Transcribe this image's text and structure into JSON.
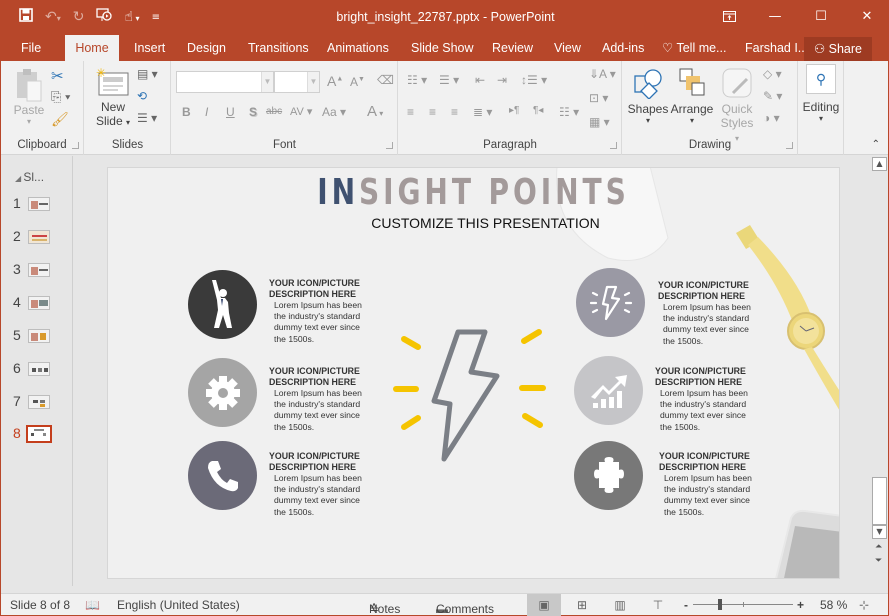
{
  "window": {
    "title": "bright_insight_22787.pptx - PowerPoint",
    "controls": [
      "ribbon-display-options",
      "minimize",
      "maximize",
      "close"
    ]
  },
  "quick_access": [
    "save-icon",
    "undo-icon",
    "redo-icon",
    "start-from-beginning-icon",
    "touch-mode-icon",
    "customize-qat-icon"
  ],
  "tabs": [
    {
      "label": "File"
    },
    {
      "label": "Home",
      "active": true
    },
    {
      "label": "Insert"
    },
    {
      "label": "Design"
    },
    {
      "label": "Transitions"
    },
    {
      "label": "Animations"
    },
    {
      "label": "Slide Show"
    },
    {
      "label": "Review"
    },
    {
      "label": "View"
    },
    {
      "label": "Add-ins"
    },
    {
      "label": "Tell me..."
    },
    {
      "label": "Farshad I..."
    }
  ],
  "share_label": "Share",
  "ribbon": {
    "groups": {
      "clipboard": {
        "label": "Clipboard",
        "paste": "Paste"
      },
      "slides": {
        "label": "Slides",
        "new_slide_1": "New",
        "new_slide_2": "Slide"
      },
      "font": {
        "label": "Font",
        "font_name": "",
        "font_size": "",
        "buttons": [
          "B",
          "I",
          "U",
          "S",
          "abc",
          "AV",
          "Aa",
          "A"
        ]
      },
      "paragraph": {
        "label": "Paragraph"
      },
      "drawing": {
        "label": "Drawing",
        "shapes": "Shapes",
        "arrange": "Arrange",
        "quick_1": "Quick",
        "quick_2": "Styles"
      },
      "editing": {
        "label": "Editing"
      }
    }
  },
  "slides_pane": {
    "header": "Sl...",
    "slides": [
      {
        "num": "1"
      },
      {
        "num": "2"
      },
      {
        "num": "3"
      },
      {
        "num": "4"
      },
      {
        "num": "5"
      },
      {
        "num": "6"
      },
      {
        "num": "7"
      },
      {
        "num": "8",
        "selected": true
      }
    ]
  },
  "slide": {
    "title_highlight": "IN",
    "title_rest": "SIGHT POINTS",
    "subtitle": "CUSTOMIZE THIS PRESENTATION",
    "items": [
      {
        "icon": "celebrating-person-icon",
        "color": "#3a3a3a",
        "heading1": "YOUR ICON/PICTURE",
        "heading2": "DESCRIPTION HERE",
        "body": [
          "Lorem Ipsum has been",
          "the industry's standard",
          "dummy text ever since",
          "the 1500s."
        ]
      },
      {
        "icon": "gear-icon",
        "color": "#a5a5a5",
        "heading1": "YOUR ICON/PICTURE",
        "heading2": "DESCRIPTION HERE",
        "body": [
          "Lorem Ipsum has been",
          "the industry's standard",
          "dummy text ever since",
          "the 1500s."
        ]
      },
      {
        "icon": "phone-icon",
        "color": "#6b6a78",
        "heading1": "YOUR ICON/PICTURE",
        "heading2": "DESCRIPTION HERE",
        "body": [
          "Lorem Ipsum has been",
          "the industry's standard",
          "dummy text ever since",
          "the 1500s."
        ]
      },
      {
        "icon": "lightning-icon",
        "color": "#9a99a4",
        "heading1": "YOUR ICON/PICTURE",
        "heading2": "DESCRIPTION HERE",
        "body": [
          "Lorem Ipsum has been",
          "the industry's standard",
          "dummy text ever since",
          "the 1500s."
        ]
      },
      {
        "icon": "growth-chart-icon",
        "color": "#c5c5c8",
        "heading1": "YOUR ICON/PICTURE",
        "heading2": "DESCRIPTION HERE",
        "body": [
          "Lorem Ipsum has been",
          "the industry's standard",
          "dummy text ever since",
          "the 1500s."
        ]
      },
      {
        "icon": "puzzle-icon",
        "color": "#787878",
        "heading1": "YOUR ICON/PICTURE",
        "heading2": "DESCRIPTION HERE",
        "body": [
          "Lorem Ipsum has been",
          "the industry's standard",
          "dummy text ever since",
          "the 1500s."
        ]
      }
    ],
    "colors": {
      "title_highlight": "#3f5170",
      "title_rest": "#a39a9a",
      "center_bolt": "#7b7f86",
      "rays": "#f5c400"
    }
  },
  "status": {
    "slide_info": "Slide 8 of 8",
    "language": "English (United States)",
    "notes": "Notes",
    "comments": "Comments",
    "zoom_level": "58 %",
    "zoom_percent": 58
  }
}
